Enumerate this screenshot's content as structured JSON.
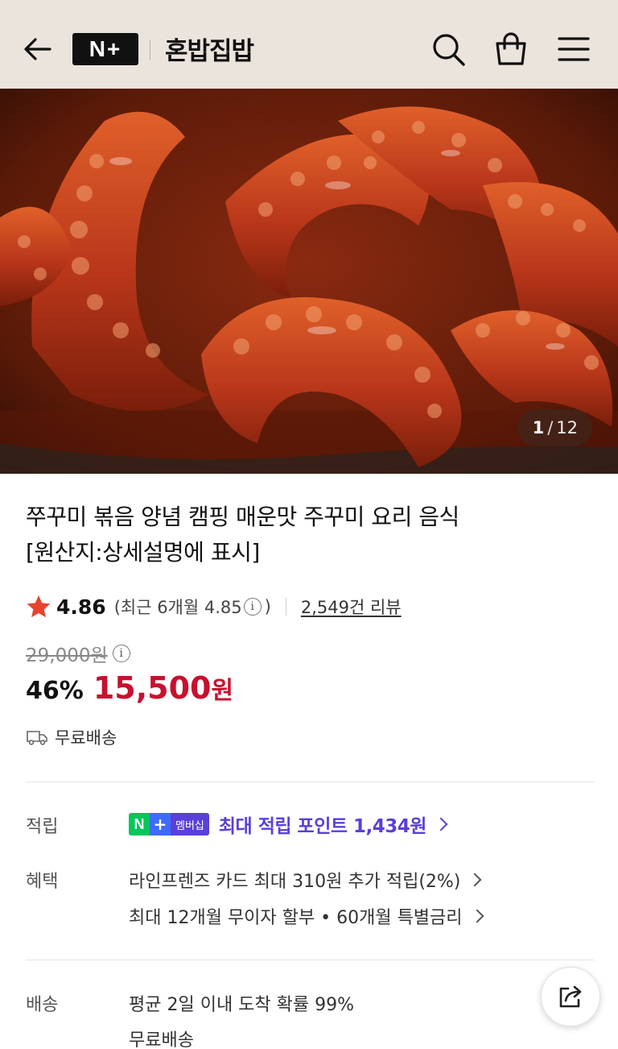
{
  "header": {
    "logo_text": "N+",
    "store_name": "혼밥집밥",
    "icons": [
      "back-arrow-icon",
      "search-icon",
      "shopping-bag-icon",
      "menu-icon"
    ]
  },
  "gallery": {
    "current": "1",
    "separator": "/",
    "total": "12"
  },
  "product": {
    "title_line1": "쭈꾸미 볶음 양념 캠핑 매운맛 주꾸미 요리 음식",
    "title_line2": "[원산지:상세설명에 표시]",
    "rating": "4.86",
    "recent_rating_prefix": "(최근 6개월 4.85",
    "recent_rating_suffix": ")",
    "review_count": "2,549건 리뷰",
    "original_price": "29,000원",
    "discount": "46%",
    "sale_price": "15,500",
    "sale_unit": "원",
    "shipping_summary": "무료배송"
  },
  "points": {
    "label": "적립",
    "badge_n": "N",
    "badge_plus": "+",
    "badge_text": "멤버십",
    "text": "최대 적립 포인트 1,434원"
  },
  "benefits": {
    "label": "혜택",
    "items": [
      "라인프렌즈 카드 최대 310원 추가 적립(2%)",
      "최대 12개월 무이자 할부 • 60개월 특별금리"
    ]
  },
  "delivery": {
    "label": "배송",
    "line1": "평균 2일 이내 도착 확률 99%",
    "line2": "무료배송"
  },
  "colors": {
    "header_bg": "#ebe4dd",
    "sale_red": "#c8102e",
    "membership_purple": "#5b3fd9",
    "star_red": "#e8432e"
  }
}
